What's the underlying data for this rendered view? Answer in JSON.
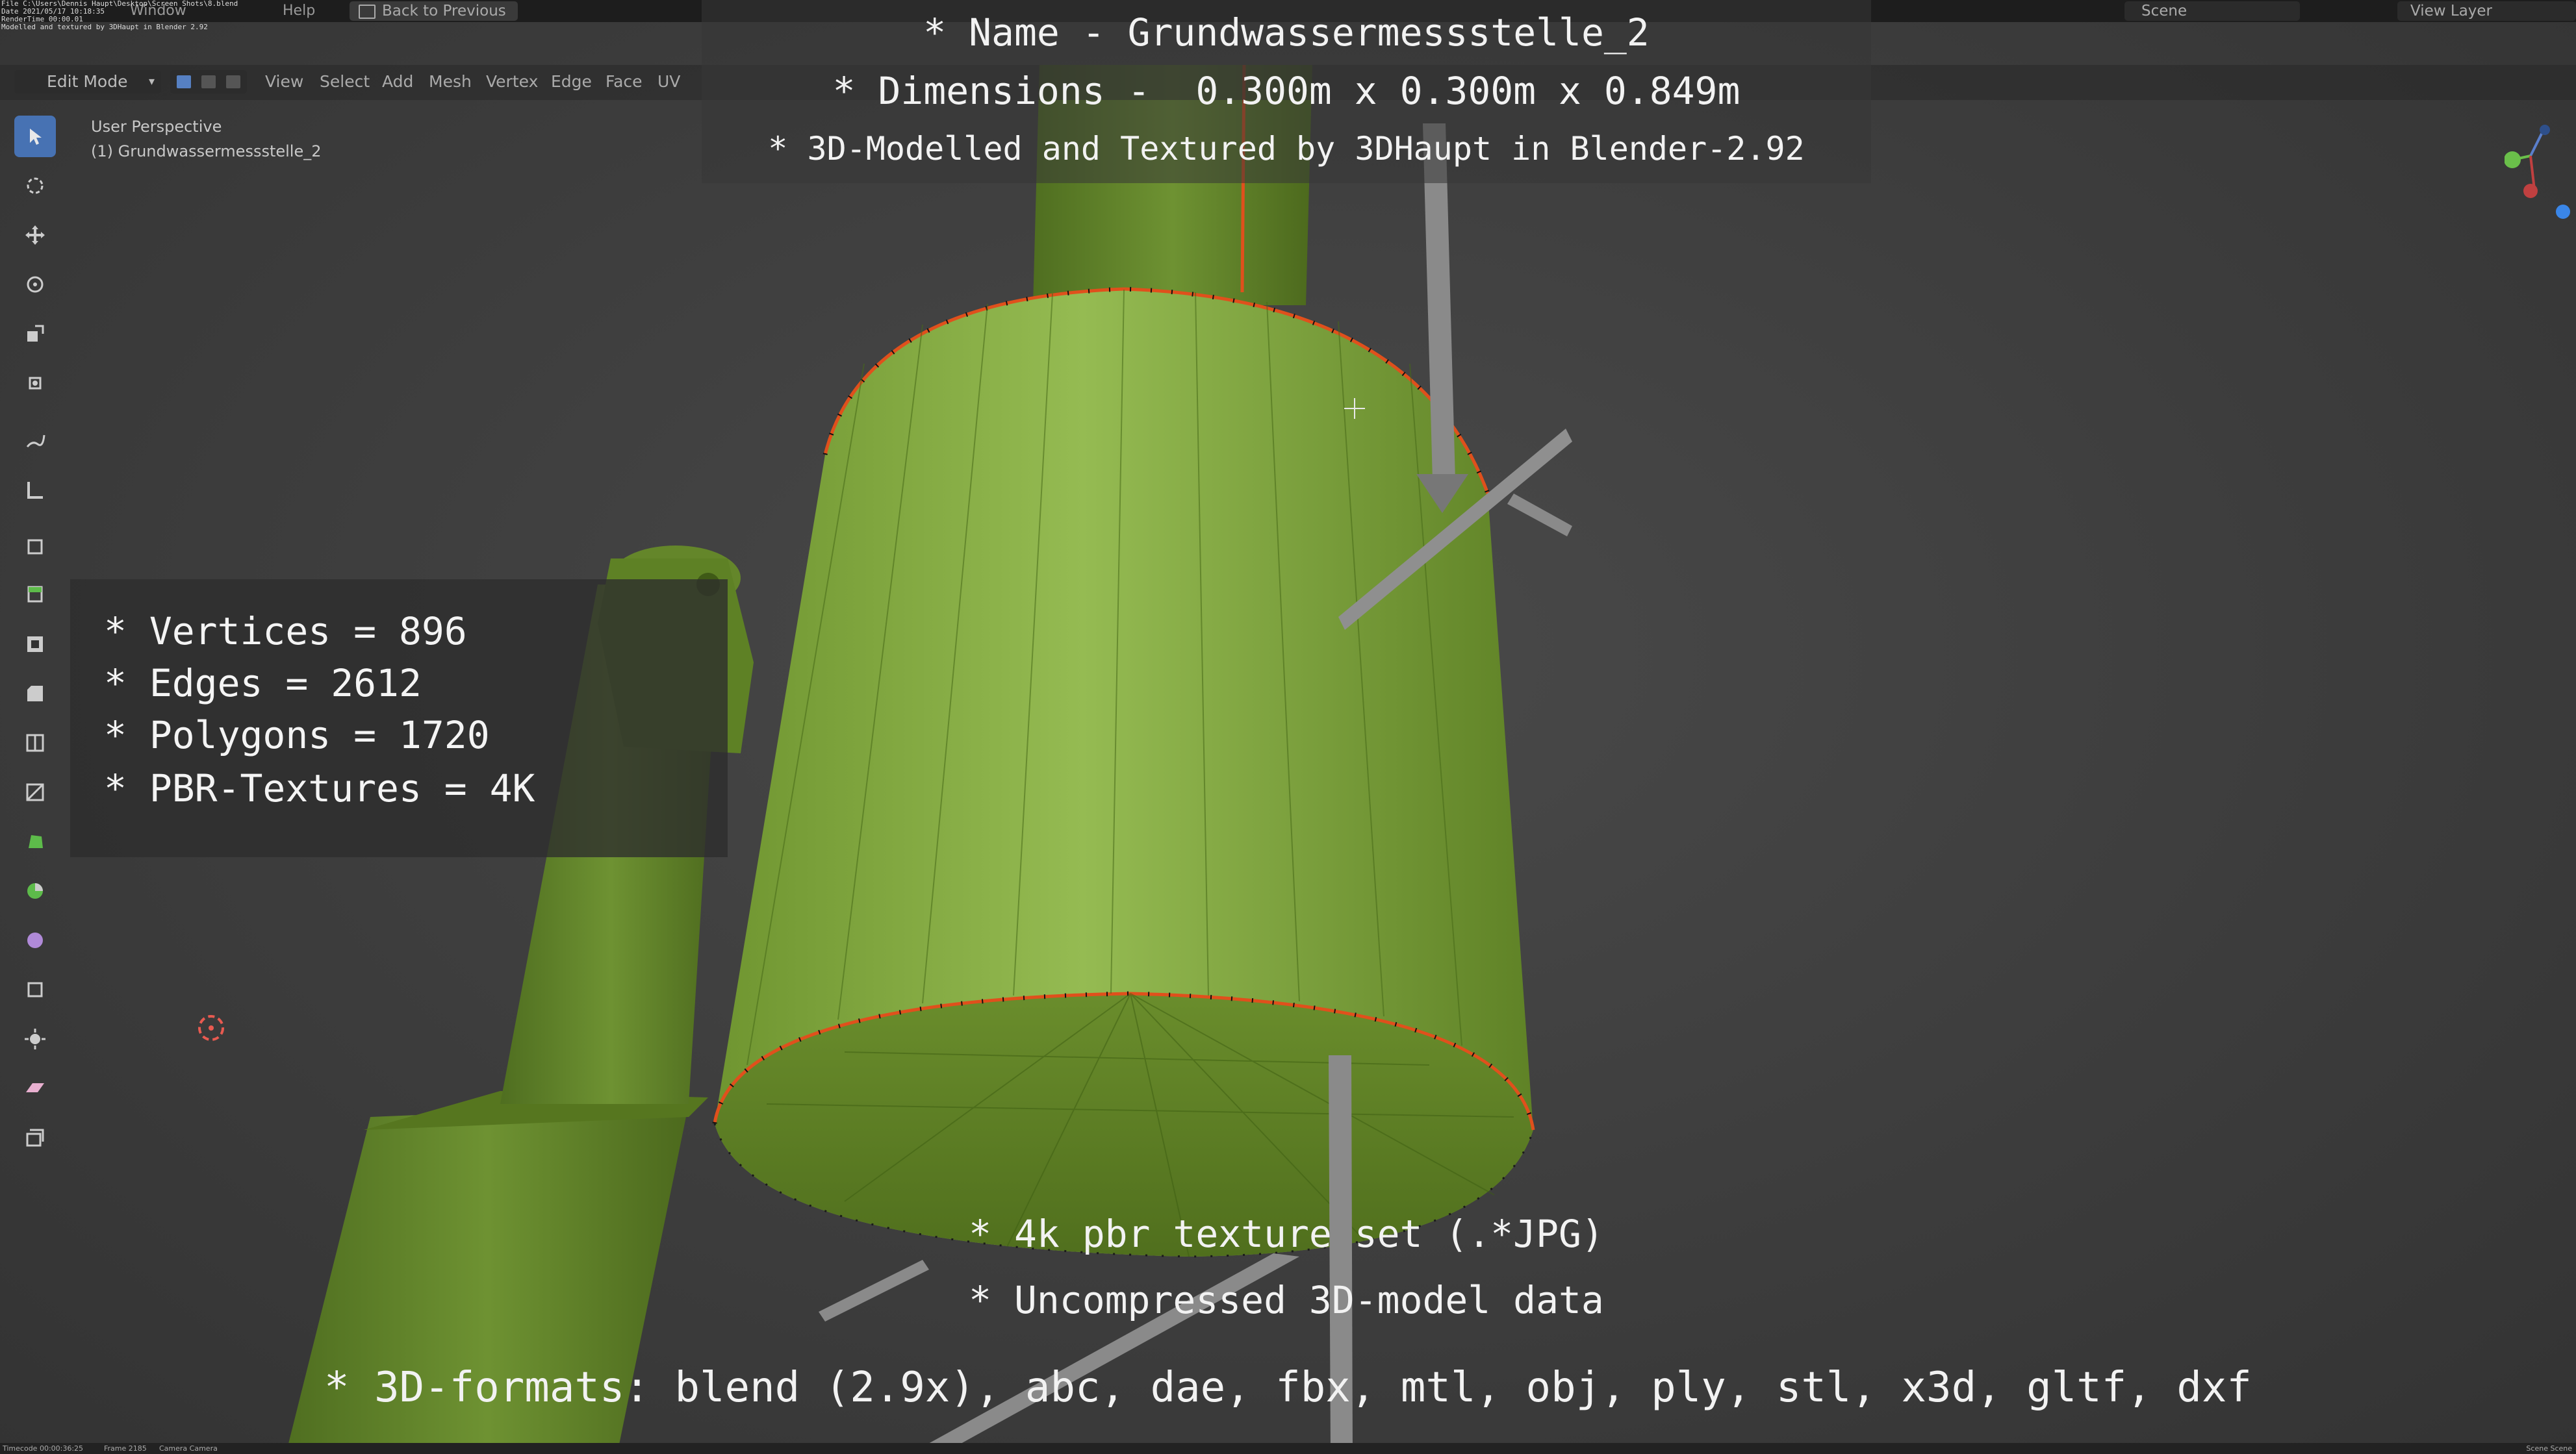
{
  "file_info": [
    "File C:\\Users\\Dennis Haupt\\Desktop\\Screen Shots\\8.blend",
    "Date 2021/05/17 10:18:35",
    "RenderTime 00:00.01",
    "Modelled and textured by 3DHaupt in Blender 2.92"
  ],
  "topbar": {
    "menus": [
      "Window",
      "Help"
    ],
    "back_button": "Back to Previous",
    "scene": "Scene",
    "view_layer": "View Layer"
  },
  "header": {
    "mode": "Edit Mode",
    "menus": [
      "View",
      "Select",
      "Add",
      "Mesh",
      "Vertex",
      "Edge",
      "Face",
      "UV"
    ]
  },
  "viewport_info": {
    "perspective": "User Perspective",
    "object": "(1) Grundwassermessstelle_2"
  },
  "overlay_top": {
    "name": "* Name - Grundwassermessstelle_2",
    "dimensions": "* Dimensions -  0.300m x 0.300m x 0.849m",
    "credit": "* 3D-Modelled and Textured by 3DHaupt in Blender-2.92"
  },
  "stats": {
    "vertices": "* Vertices = 896",
    "edges": "* Edges = 2612",
    "polygons": "* Polygons = 1720",
    "textures": "* PBR-Textures = 4K"
  },
  "overlay_bottom": {
    "texture_set": "* 4k pbr texture set (.*JPG)",
    "uncompressed": "* Uncompressed 3D-model data",
    "formats": "* 3D-formats: blend (2.9x), abc, dae, fbx, mtl, obj, ply, stl, x3d, gltf, dxf"
  },
  "status": {
    "timecode": "Timecode 00:00:36:25",
    "frame": "Frame 2185",
    "camera": "Camera Camera",
    "scene": "Scene Scene"
  },
  "colors": {
    "object_green": "#7fa63a",
    "edge_orange": "#e0501c",
    "accent_blue": "#4772b3"
  },
  "tools": [
    "select-tool-icon",
    "cursor-icon",
    "move-icon",
    "rotate-icon",
    "scale-icon",
    "transform-icon",
    "annotate-icon",
    "measure-icon",
    "add-cube-icon",
    "extrude-icon",
    "inset-icon",
    "bevel-icon",
    "loop-cut-icon",
    "knife-icon",
    "poly-build-icon",
    "spin-icon",
    "smooth-icon",
    "edge-slide-icon",
    "shrink-icon",
    "shear-icon",
    "rip-icon"
  ]
}
